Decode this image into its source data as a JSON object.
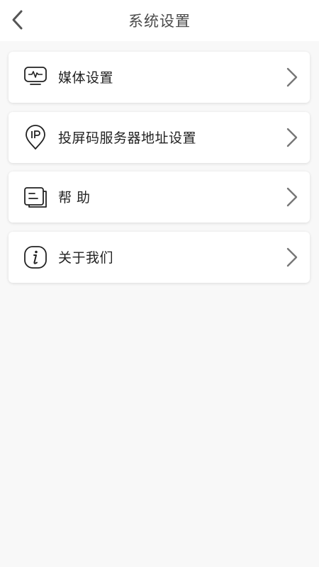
{
  "header": {
    "title": "系统设置",
    "back_icon": "chevron-left-icon"
  },
  "menu": [
    {
      "label": "媒体设置",
      "icon": "media-monitor-icon"
    },
    {
      "label": "投屏码服务器地址设置",
      "icon": "ip-location-pin-icon"
    },
    {
      "label": "帮 助",
      "icon": "help-document-icon"
    },
    {
      "label": "关于我们",
      "icon": "info-icon"
    }
  ],
  "colors": {
    "background": "#f8f8f8",
    "card": "#ffffff",
    "text": "#222222",
    "title": "#4a4a4a",
    "chevron": "#777777"
  }
}
